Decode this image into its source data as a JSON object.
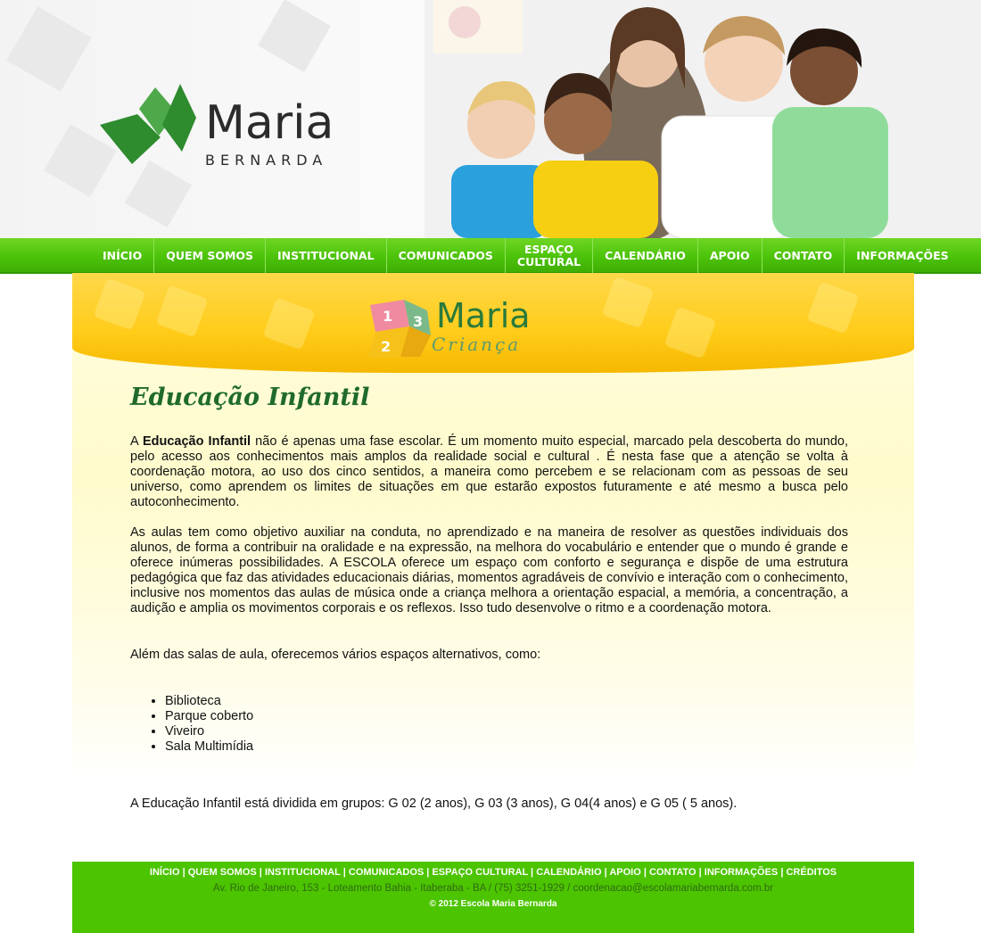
{
  "header": {
    "logo_main": "Maria",
    "logo_sub": "BERNARDA"
  },
  "nav": {
    "items": [
      "INÍCIO",
      "QUEM SOMOS",
      "INSTITUCIONAL",
      "COMUNICADOS",
      "ESPAÇO\nCULTURAL",
      "CALENDÁRIO",
      "APOIO",
      "CONTATO",
      "INFORMAÇÕES"
    ]
  },
  "banner": {
    "brand_main": "Maria",
    "brand_sub": "Criança",
    "cube_numbers": [
      "1",
      "2",
      "3"
    ]
  },
  "main": {
    "title": "Educação Infantil",
    "p1_lead": "A ",
    "p1_bold": "Educação Infantil",
    "p1_rest": " não é apenas uma fase escolar. É um momento muito especial, marcado pela descoberta do mundo, pelo acesso aos conhecimentos mais amplos da realidade social e cultural . É nesta fase que a atenção se volta à coordenação motora, ao uso dos cinco sentidos, a maneira como percebem e se relacionam com as pessoas de seu universo, como aprendem os limites de situações em que estarão expostos futuramente e até mesmo a busca pelo autoconhecimento.",
    "p2": "As aulas tem como objetivo auxiliar na conduta, no aprendizado e na maneira de resolver as questões individuais dos alunos, de forma a contribuir na oralidade e na expressão, na melhora do vocabulário e entender que o mundo é grande e oferece inúmeras possibilidades. A ESCOLA oferece um espaço com conforto e segurança e dispõe de uma estrutura pedagógica que faz das atividades educacionais diárias, momentos agradáveis de convívio e interação com o conhecimento, inclusive nos momentos das aulas de música onde a criança melhora a orientação espacial, a memória, a concentração, a audição e amplia os movimentos corporais e os reflexos. Isso tudo desenvolve o ritmo e a coordenação motora.",
    "p3": "Além das salas de aula, oferecemos vários espaços alternativos, como:",
    "spaces": [
      "Biblioteca",
      "Parque coberto",
      "Viveiro",
      "Sala Multimídia"
    ],
    "closing": "A Educação Infantil está dividida em grupos: G 02 (2 anos), G 03 (3 anos), G 04(4 anos) e G 05 ( 5 anos)."
  },
  "footer": {
    "links": [
      "INÍCIO",
      "QUEM SOMOS",
      "INSTITUCIONAL",
      "COMUNICADOS",
      "ESPAÇO CULTURAL",
      "CALENDÁRIO",
      "APOIO",
      "CONTATO",
      "INFORMAÇÕES",
      "CRÉDITOS"
    ],
    "separator": " | ",
    "address": "Av. Rio de Janeiro, 153 - Loteamento Bahia - Itaberaba - BA / (75) 3251-1929 / coordenacao@escolamariabernarda.com.br",
    "copyright": "© 2012 Escola Maria Bernarda"
  },
  "colors": {
    "nav_green": "#4cc30a",
    "footer_green": "#4cc400",
    "title_green": "#1f6a2c",
    "banner_yellow": "#ffcc1a",
    "logo_green": "#2e8b2e"
  }
}
